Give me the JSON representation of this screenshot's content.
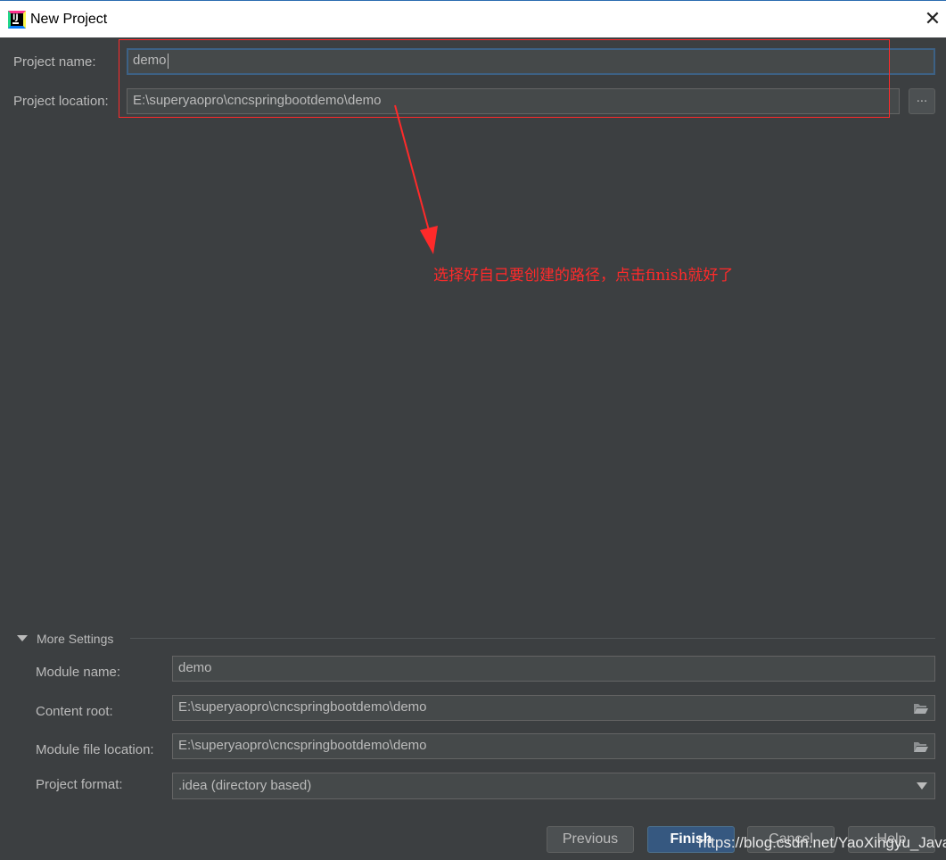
{
  "window": {
    "title": "New Project",
    "app_icon": "intellij-idea-icon",
    "close_icon": "close-icon"
  },
  "form": {
    "project_name_label": "Project name:",
    "project_name_value": "demo",
    "project_location_label": "Project location:",
    "project_location_value": "E:\\superyaopro\\cncspringbootdemo\\demo",
    "browse_label": "..."
  },
  "annotation": {
    "text": "选择好自己要创建的路径，点击finish就好了",
    "color": "#ff2a2a"
  },
  "more_settings": {
    "label": "More Settings",
    "expanded": true,
    "module_name_label": "Module name:",
    "module_name_value": "demo",
    "content_root_label": "Content root:",
    "content_root_value": "E:\\superyaopro\\cncspringbootdemo\\demo",
    "module_file_location_label": "Module file location:",
    "module_file_location_value": "E:\\superyaopro\\cncspringbootdemo\\demo",
    "project_format_label": "Project format:",
    "project_format_value": ".idea (directory based)"
  },
  "buttons": {
    "previous": "Previous",
    "finish": "Finish",
    "cancel": "Cancel",
    "help": "Help"
  },
  "watermark": "https://blog.csdn.net/YaoXingyu_Java",
  "colors": {
    "background": "#3c3f41",
    "field": "#45494a",
    "text": "#bbbbbb",
    "primary_button": "#365880",
    "focus_border": "#3d6185"
  }
}
